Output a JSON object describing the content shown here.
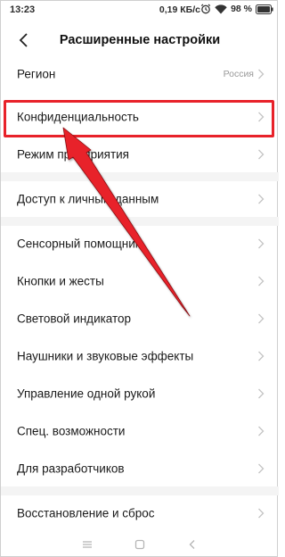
{
  "status_bar": {
    "time": "13:23",
    "network_speed": "0,19 КБ/с",
    "battery_percent": "98 %",
    "icons": [
      "alarm-icon",
      "wifi-icon",
      "battery-icon"
    ]
  },
  "header": {
    "title": "Расширенные настройки",
    "back_icon": "back-arrow-icon"
  },
  "rows": [
    {
      "label": "Регион",
      "value": "Россия"
    },
    {
      "label": "Конфиденциальность",
      "value": ""
    },
    {
      "label": "Режим предприятия",
      "value": ""
    },
    {
      "label": "Доступ к личным данным",
      "value": ""
    },
    {
      "label": "Сенсорный помощник",
      "value": ""
    },
    {
      "label": "Кнопки и жесты",
      "value": ""
    },
    {
      "label": "Световой индикатор",
      "value": ""
    },
    {
      "label": "Наушники и звуковые эффекты",
      "value": ""
    },
    {
      "label": "Управление одной рукой",
      "value": ""
    },
    {
      "label": "Спец. возможности",
      "value": ""
    },
    {
      "label": "Для разработчиков",
      "value": ""
    },
    {
      "label": "Восстановление и сброс",
      "value": ""
    }
  ],
  "annotation": {
    "color": "#e8222a",
    "highlighted_row": "Конфиденциальность"
  },
  "nav_bar": {
    "icons": [
      "menu-icon",
      "home-icon",
      "back-icon"
    ]
  },
  "colors": {
    "accent": "#e8222a",
    "chevron": "#c4c4c4",
    "secondary_text": "#999999",
    "divider": "#f4f4f4"
  }
}
